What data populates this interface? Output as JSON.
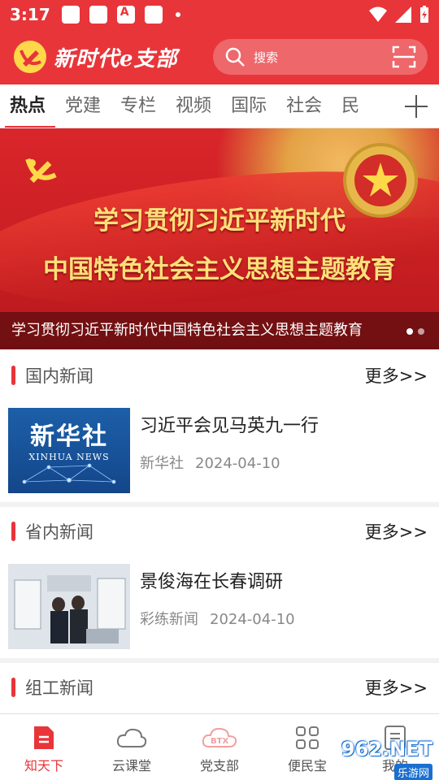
{
  "status_bar": {
    "time": "3:17"
  },
  "header": {
    "app_title": "新时代e支部",
    "search_placeholder": "搜索"
  },
  "tabs": [
    "热点",
    "党建",
    "专栏",
    "视频",
    "国际",
    "社会",
    "民"
  ],
  "banner": {
    "line1": "学习贯彻习近平新时代",
    "line2": "中国特色社会主义思想主题教育",
    "caption": "学习贯彻习近平新时代中国特色社会主义思想主题教育"
  },
  "sections": [
    {
      "title": "国内新闻",
      "more": "更多>>",
      "news": {
        "title": "习近平会见马英九一行",
        "source": "新华社",
        "date": "2024-04-10",
        "thumb_cn": "新华社",
        "thumb_en": "XINHUA NEWS"
      }
    },
    {
      "title": "省内新闻",
      "more": "更多>>",
      "news": {
        "title": "景俊海在长春调研",
        "source": "彩练新闻",
        "date": "2024-04-10"
      }
    },
    {
      "title": "组工新闻",
      "more": "更多>>"
    }
  ],
  "bottom_nav": [
    "知天下",
    "云课堂",
    "党支部",
    "便民宝",
    "我的"
  ],
  "watermark": {
    "text": "962.NET",
    "sub": "乐游网"
  },
  "colors": {
    "primary": "#e8353a",
    "gold": "#ffe07a"
  }
}
